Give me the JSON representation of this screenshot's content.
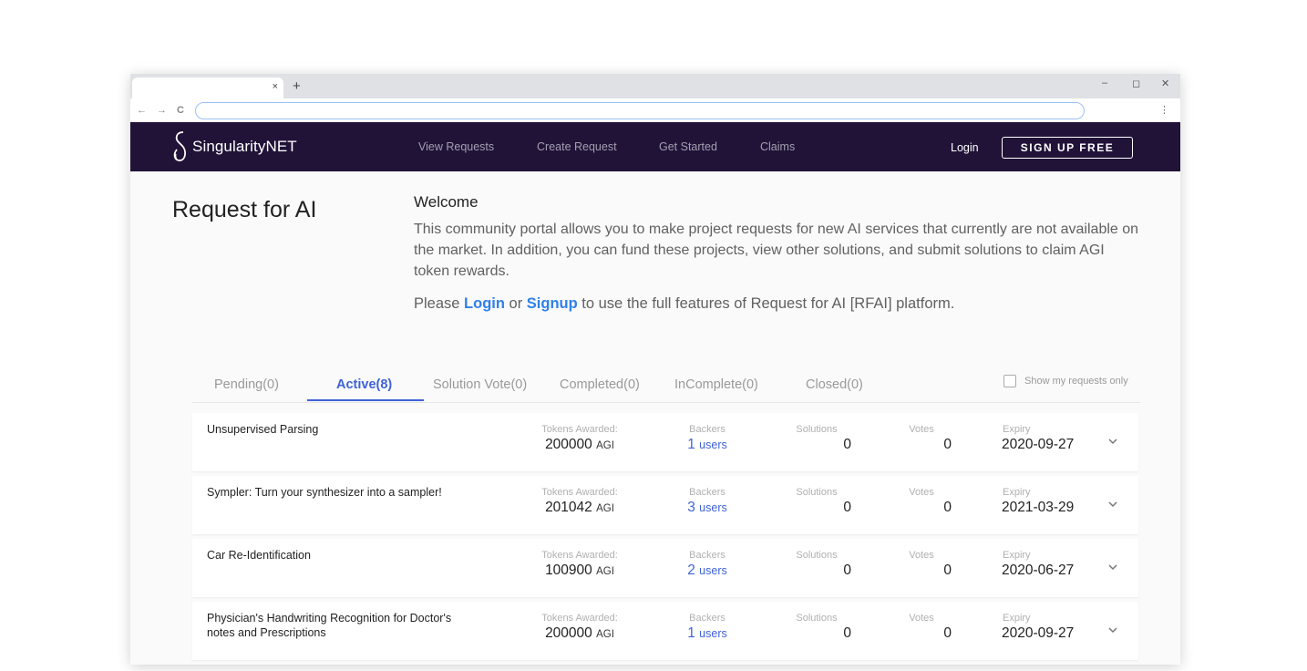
{
  "browser": {
    "tab_close": "×",
    "new_tab": "+",
    "window_controls": [
      "–",
      "◻",
      "✕"
    ],
    "nav": [
      "←",
      "→",
      "C"
    ],
    "menu": "⋮"
  },
  "navbar": {
    "brand": "SingularityNET",
    "links": [
      "View Requests",
      "Create Request",
      "Get Started",
      "Claims"
    ],
    "login": "Login",
    "signup": "SIGN UP FREE"
  },
  "page": {
    "title": "Request for AI",
    "welcome_title": "Welcome",
    "welcome_text": "This community portal allows you to make project requests for new AI services that currently are not available on the market. In addition, you can fund these projects, view other solutions, and submit solutions to claim AGI token rewards.",
    "cta_prefix": "Please ",
    "cta_login": "Login",
    "cta_or": " or ",
    "cta_signup": "Signup",
    "cta_suffix": " to use the full features of Request for AI [RFAI] platform."
  },
  "tabs": [
    {
      "label": "Pending(0)",
      "active": false
    },
    {
      "label": "Active(8)",
      "active": true
    },
    {
      "label": "Solution Vote(0)",
      "active": false
    },
    {
      "label": "Completed(0)",
      "active": false
    },
    {
      "label": "InComplete(0)",
      "active": false
    },
    {
      "label": "Closed(0)",
      "active": false
    }
  ],
  "show_mine": "Show my requests only",
  "columns": {
    "tokens": "Tokens Awarded:",
    "backers": "Backers",
    "solutions": "Solutions",
    "votes": "Votes",
    "expiry": "Expiry"
  },
  "unit": "AGI",
  "users_word": "users",
  "requests": [
    {
      "title": "Unsupervised Parsing",
      "tokens": "200000",
      "backers": "1",
      "solutions": "0",
      "votes": "0",
      "expiry": "2020-09-27"
    },
    {
      "title": "Sympler: Turn your synthesizer into a sampler!",
      "tokens": "201042",
      "backers": "3",
      "solutions": "0",
      "votes": "0",
      "expiry": "2021-03-29"
    },
    {
      "title": "Car Re-Identification",
      "tokens": "100900",
      "backers": "2",
      "solutions": "0",
      "votes": "0",
      "expiry": "2020-06-27"
    },
    {
      "title": "Physician's Handwriting Recognition for Doctor's notes and Prescriptions",
      "tokens": "200000",
      "backers": "1",
      "solutions": "0",
      "votes": "0",
      "expiry": "2020-09-27"
    }
  ],
  "colors": {
    "navbar_bg": "#211338",
    "accent": "#3f62d8",
    "link": "#2f80ed"
  }
}
